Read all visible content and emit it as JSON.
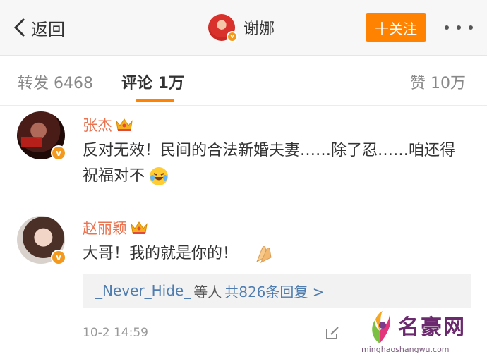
{
  "header": {
    "back_label": "返回",
    "title": "谢娜",
    "follow_label": "十关注"
  },
  "tabs": {
    "repost": "转发 6468",
    "comments": "评论 1万",
    "likes": "赞 10万"
  },
  "comments": [
    {
      "author": "张杰",
      "text": "反对无效！民间的合法新婚夫妻……除了忍……咱还得祝福对不"
    },
    {
      "author": "赵丽颖",
      "text": "大哥！我的就是你的！",
      "reply_users": "_Never_Hide_",
      "reply_mid": "等人",
      "reply_count": "共826条回复 >",
      "time": "10-2 14:59"
    }
  ],
  "watermark": {
    "name": "名豪网",
    "url": "minghaoshangwu.com"
  },
  "colors": {
    "accent": "#ff8200",
    "author": "#eb7350",
    "link": "#507daf"
  }
}
